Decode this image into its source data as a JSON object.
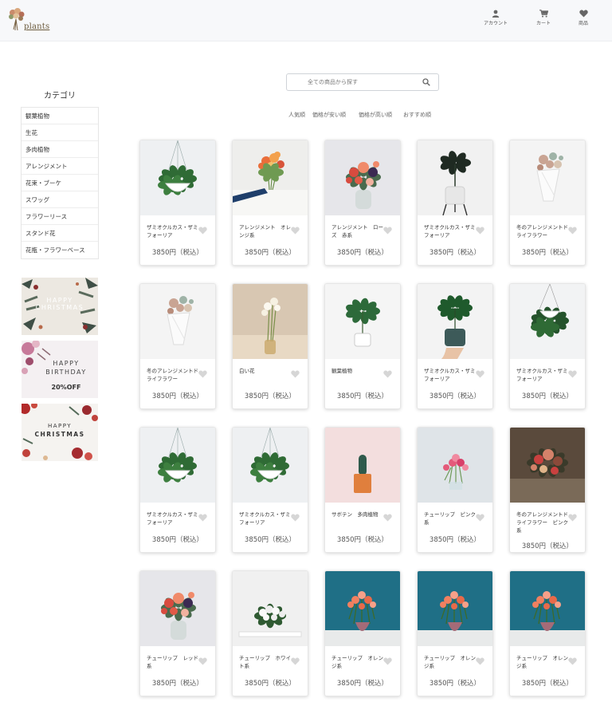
{
  "header": {
    "logo_text": "plants",
    "nav": [
      {
        "label": "アカウント",
        "icon": "user-icon"
      },
      {
        "label": "カート",
        "icon": "cart-icon"
      },
      {
        "label": "商品",
        "icon": "heart-icon"
      }
    ]
  },
  "sidebar": {
    "title": "カテゴリ",
    "categories": [
      "観葉植物",
      "生花",
      "多肉植物",
      "アレンジメント",
      "花束・ブーケ",
      "スワッグ",
      "フラワーリース",
      "スタンド花",
      "花瓶・フラワーベース"
    ],
    "banners": [
      {
        "text": "HAPPY CHRISTMAS"
      },
      {
        "line1": "HAPPY",
        "line2": "BIRTHDAY",
        "line3": "20%OFF"
      },
      {
        "line1": "HAPPY",
        "line2": "CHRISTMAS"
      }
    ]
  },
  "search": {
    "placeholder": "全ての商品から探す"
  },
  "sort": [
    "人気順",
    "価格が安い順",
    "価格が高い順",
    "おすすめ順"
  ],
  "products": [
    {
      "name": "ザミオクルカス・ザミフォーリア",
      "price": "3850円（税込）",
      "image": "hanging-pothos"
    },
    {
      "name": "アレンジメント　オレンジ系",
      "price": "3850円（税込）",
      "image": "hand-bouquet"
    },
    {
      "name": "アレンジメント　ローズ　赤系",
      "price": "3850円（税込）",
      "image": "red-vase-arrangement"
    },
    {
      "name": "ザミオクルカス・ザミフォーリア",
      "price": "3850円（税込）",
      "image": "rubber-plant-stand"
    },
    {
      "name": "冬のアレンジメントドライフラワー",
      "price": "3850円（税込）",
      "image": "dried-bouquet-paper"
    },
    {
      "name": "冬のアレンジメントドライフラワー",
      "price": "3850円（税込）",
      "image": "dried-bouquet-paper"
    },
    {
      "name": "白い花",
      "price": "3850円（税込）",
      "image": "white-calla"
    },
    {
      "name": "観葉植物",
      "price": "3850円（税込）",
      "image": "small-leaf-plant"
    },
    {
      "name": "ザミオクルカス・ザミフォーリア",
      "price": "3850円（税込）",
      "image": "zz-plant-hand"
    },
    {
      "name": "ザミオクルカス・ザミフォーリア",
      "price": "3850円（税込）",
      "image": "hanging-pothos-2"
    },
    {
      "name": "ザミオクルカス・ザミフォーリア",
      "price": "3850円（税込）",
      "image": "hanging-pothos"
    },
    {
      "name": "ザミオクルカス・ザミフォーリア",
      "price": "3850円（税込）",
      "image": "hanging-pothos"
    },
    {
      "name": "サボテン　多肉植物",
      "price": "3850円（税込）",
      "image": "cactus-pot"
    },
    {
      "name": "チューリップ　ピンク系",
      "price": "3850円（税込）",
      "image": "pink-tulips"
    },
    {
      "name": "冬のアレンジメントドライフラワー　ピンク系",
      "price": "3850円（税込）",
      "image": "dark-dried-bouquet"
    },
    {
      "name": "チューリップ　レッド系",
      "price": "3850円（税込）",
      "image": "red-vase-arrangement"
    },
    {
      "name": "チューリップ　ホワイト系",
      "price": "3850円（税込）",
      "image": "white-roses"
    },
    {
      "name": "チューリップ　オレンジ系",
      "price": "3850円（税込）",
      "image": "orange-tulips-blue"
    },
    {
      "name": "チューリップ　オレンジ系",
      "price": "3850円（税込）",
      "image": "orange-tulips-blue"
    },
    {
      "name": "チューリップ　オレンジ系",
      "price": "3850円（税込）",
      "image": "orange-tulips-blue"
    }
  ]
}
